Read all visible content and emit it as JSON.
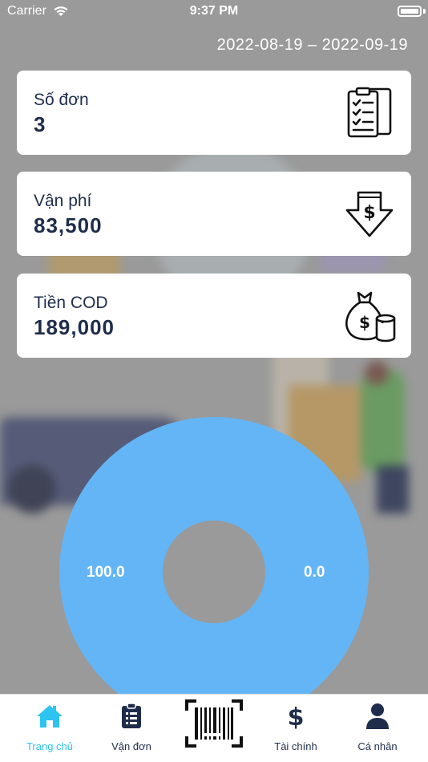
{
  "status_bar": {
    "carrier": "Carrier",
    "time": "9:37 PM"
  },
  "date_range": "2022-08-19 – 2022-09-19",
  "cards": [
    {
      "label": "Số đơn",
      "value": "3",
      "icon": "clipboard-checklist-icon"
    },
    {
      "label": "Vận phí",
      "value": "83,500",
      "icon": "arrow-down-dollar-icon"
    },
    {
      "label": "Tiền COD",
      "value": "189,000",
      "icon": "money-bag-coins-icon"
    }
  ],
  "chart_data": {
    "type": "pie",
    "donut": true,
    "slices": [
      {
        "value": 100.0,
        "label": "100.0",
        "color": "#64b5f6"
      },
      {
        "value": 0.0,
        "label": "0.0",
        "color": "#64b5f6"
      }
    ]
  },
  "tabs": [
    {
      "label": "Trang chủ",
      "icon": "home-icon",
      "active": true
    },
    {
      "label": "Vận đơn",
      "icon": "clipboard-list-icon",
      "active": false
    },
    {
      "label": "",
      "icon": "barcode-scan-icon",
      "active": false
    },
    {
      "label": "Tài chính",
      "icon": "dollar-icon",
      "active": false
    },
    {
      "label": "Cá nhân",
      "icon": "user-icon",
      "active": false
    }
  ],
  "colors": {
    "background": "#9a9a9a",
    "accent": "#2ec4f1",
    "text_dark": "#1f2d4a",
    "chart_fill": "#64b5f6"
  }
}
